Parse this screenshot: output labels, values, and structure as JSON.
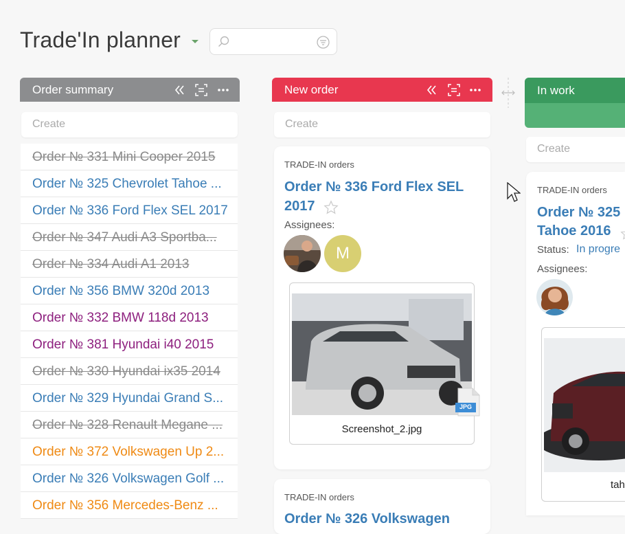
{
  "header": {
    "title": "Trade'In planner",
    "search": {
      "placeholder": ""
    }
  },
  "columns": [
    {
      "name": "Order summary",
      "color": "#8c8d8f",
      "create_placeholder": "Create",
      "items": [
        {
          "label": "Order № 331 Mini Cooper 2015",
          "state": "done"
        },
        {
          "label": "Order № 325 Chevrolet Tahoe ...",
          "state": "blue"
        },
        {
          "label": "Order № 336 Ford Flex SEL 2017",
          "state": "blue"
        },
        {
          "label": "Order № 347 Audi A3 Sportba...",
          "state": "done"
        },
        {
          "label": "Order № 334 Audi A1 2013",
          "state": "done"
        },
        {
          "label": "Order № 356 BMW 320d 2013",
          "state": "blue"
        },
        {
          "label": "Order № 332 BMW 118d 2013",
          "state": "purple"
        },
        {
          "label": "Order № 381 Hyundai i40 2015",
          "state": "purple"
        },
        {
          "label": "Order № 330 Hyundai ix35 2014",
          "state": "done"
        },
        {
          "label": "Order № 329 Hyundai Grand S...",
          "state": "blue"
        },
        {
          "label": "Order № 328 Renault Megane ...",
          "state": "done"
        },
        {
          "label": "Order № 372 Volkswagen Up 2...",
          "state": "orange"
        },
        {
          "label": "Order № 326 Volkswagen Golf ...",
          "state": "blue"
        },
        {
          "label": "Order № 356 Mercedes-Benz ...",
          "state": "orange"
        }
      ]
    },
    {
      "name": "New order",
      "color": "#e8374f",
      "create_placeholder": "Create",
      "cards": [
        {
          "category": "TRADE-IN orders",
          "title_line1": "Order № 336 Ford Flex SEL",
          "title_line2": "2017",
          "assignees_label": "Assignees:",
          "assignee_initial": "M",
          "attachment_name": "Screenshot_2.jpg",
          "attachment_type": "JPG"
        },
        {
          "category": "TRADE-IN orders",
          "title_line1": "Order № 326 Volkswagen"
        }
      ]
    },
    {
      "name": "In work",
      "color": "#3a9a5e",
      "create_placeholder": "Create",
      "cards": [
        {
          "category": "TRADE-IN orders",
          "title_line1": "Order № 325",
          "title_line2": "Tahoe 2016",
          "status_label": "Status:",
          "status_value": "In progre",
          "assignees_label": "Assignees:",
          "attachment_name": "tah"
        }
      ]
    }
  ]
}
